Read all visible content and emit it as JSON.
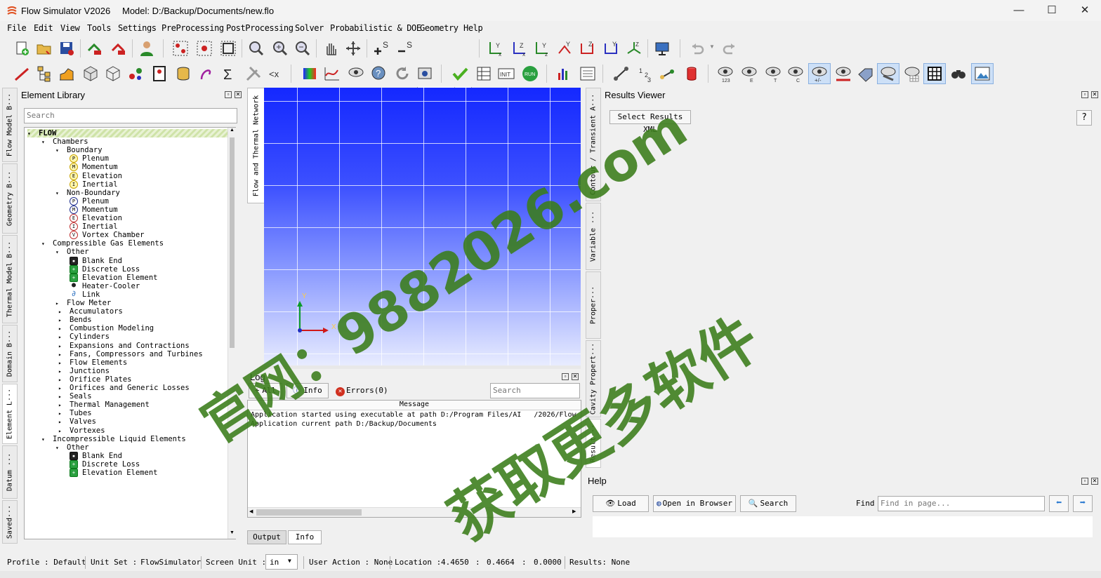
{
  "window": {
    "app_title": "Flow Simulator V2026",
    "model_label": "Model: D:/Backup/Documents/new.flo"
  },
  "menu": [
    "File",
    "Edit",
    "View",
    "Tools",
    "Settings",
    "PreProcessing",
    "PostProcessing",
    "Solver",
    "Probabilistic & DOE",
    "Geometry",
    "Help"
  ],
  "toolbar": {
    "font_size_value": "12",
    "font_icon_label": "T↕"
  },
  "left_tabs": [
    "Flow Model B···",
    "Geometry B···",
    "Thermal Model B···",
    "Domain B···",
    "Element L···",
    "Datum ···",
    "Saved···"
  ],
  "element_library": {
    "title": "Element Library",
    "search_placeholder": "Search",
    "tree": [
      {
        "d": 0,
        "arr": "▾",
        "label": "FLOW",
        "bold": true
      },
      {
        "d": 1,
        "arr": "▾",
        "label": "Chambers"
      },
      {
        "d": 2,
        "arr": "▾",
        "label": "Boundary"
      },
      {
        "d": 3,
        "icon": "P",
        "ic": "yellow",
        "label": "Plenum"
      },
      {
        "d": 3,
        "icon": "M",
        "ic": "yellow",
        "label": "Momentum"
      },
      {
        "d": 3,
        "icon": "E",
        "ic": "yellow",
        "label": "Elevation"
      },
      {
        "d": 3,
        "icon": "I",
        "ic": "yellow",
        "label": "Inertial"
      },
      {
        "d": 2,
        "arr": "▾",
        "label": "Non-Boundary"
      },
      {
        "d": 3,
        "icon": "P",
        "ic": "blue",
        "label": "Plenum"
      },
      {
        "d": 3,
        "icon": "M",
        "ic": "blue",
        "label": "Momentum"
      },
      {
        "d": 3,
        "icon": "E",
        "ic": "red",
        "label": "Elevation"
      },
      {
        "d": 3,
        "icon": "I",
        "ic": "red",
        "label": "Inertial"
      },
      {
        "d": 3,
        "icon": "V",
        "ic": "red",
        "label": "Vortex Chamber"
      },
      {
        "d": 1,
        "arr": "▾",
        "label": "Compressible Gas Elements"
      },
      {
        "d": 2,
        "arr": "▾",
        "label": "Other"
      },
      {
        "d": 3,
        "icon": "▪",
        "ic": "black",
        "label": "Blank End"
      },
      {
        "d": 3,
        "icon": "+",
        "ic": "green",
        "label": "Discrete Loss"
      },
      {
        "d": 3,
        "icon": "+",
        "ic": "green",
        "label": "Elevation Element"
      },
      {
        "d": 3,
        "icon": "●",
        "ic": "dot",
        "label": "Heater-Cooler"
      },
      {
        "d": 3,
        "icon": "∂",
        "ic": "link",
        "label": "Link"
      },
      {
        "d": 2,
        "arr": "▸",
        "label": "Flow Meter"
      },
      {
        "d": 1.6,
        "arr": "▸",
        "label": "Accumulators"
      },
      {
        "d": 1.6,
        "arr": "▸",
        "label": "Bends"
      },
      {
        "d": 1.6,
        "arr": "▸",
        "label": "Combustion Modeling"
      },
      {
        "d": 1.6,
        "arr": "▸",
        "label": "Cylinders"
      },
      {
        "d": 1.6,
        "arr": "▸",
        "label": "Expansions and Contractions"
      },
      {
        "d": 1.6,
        "arr": "▸",
        "label": "Fans, Compressors and Turbines"
      },
      {
        "d": 1.6,
        "arr": "▸",
        "label": "Flow Elements"
      },
      {
        "d": 1.6,
        "arr": "▸",
        "label": "Junctions"
      },
      {
        "d": 1.6,
        "arr": "▸",
        "label": "Orifice Plates"
      },
      {
        "d": 1.6,
        "arr": "▸",
        "label": "Orifices and Generic Losses"
      },
      {
        "d": 1.6,
        "arr": "▸",
        "label": "Seals"
      },
      {
        "d": 1.6,
        "arr": "▸",
        "label": "Thermal Management"
      },
      {
        "d": 1.6,
        "arr": "▸",
        "label": "Tubes"
      },
      {
        "d": 1.6,
        "arr": "▸",
        "label": "Valves"
      },
      {
        "d": 1.6,
        "arr": "▸",
        "label": "Vortexes"
      },
      {
        "d": 1,
        "arr": "▾",
        "label": "Incompressible Liquid Elements"
      },
      {
        "d": 2,
        "arr": "▾",
        "label": "Other"
      },
      {
        "d": 3,
        "icon": "▪",
        "ic": "black",
        "label": "Blank End"
      },
      {
        "d": 3,
        "icon": "+",
        "ic": "green",
        "label": "Discrete Loss"
      },
      {
        "d": 3,
        "icon": "+",
        "ic": "green",
        "label": "Elevation Element"
      }
    ]
  },
  "canvas": {
    "side_tab": "Flow and Thermal Network",
    "axis_y": "Y",
    "axis_x": "X"
  },
  "log": {
    "title": "Log",
    "all_button": "All",
    "info_button": "Info",
    "errors_button": "Errors(0)",
    "search_placeholder": "Search",
    "column": "Message",
    "lines": [
      "Application started using executable at path D:/Program Files/AI   /2026/Flow",
      "Application current  path D:/Backup/Documents"
    ],
    "tabs": [
      "Output",
      "Info"
    ]
  },
  "right_tabs": [
    "Contour / Transient A···",
    "Variable ···",
    "Proper···",
    "Cavity Propert···",
    "Result···"
  ],
  "results_viewer": {
    "title": "Results Viewer",
    "select_button": "Select Results XML",
    "help_icon": "?"
  },
  "help": {
    "title": "Help",
    "load": "Load",
    "open_browser": "Open in Browser",
    "search": "Search",
    "find_label": "Find",
    "find_placeholder": "Find in page..."
  },
  "status": {
    "profile": "Profile : Default",
    "unit_set_label": "Unit Set :",
    "unit_set_value": "FlowSimulator",
    "screen_unit_label": "Screen Unit :",
    "screen_unit_value": "in",
    "user_action": "User Action : None",
    "location_label": "Location :",
    "loc_x": "4.4650",
    "loc_y": "0.4664",
    "loc_z": "0.0000",
    "results": "Results: None"
  },
  "watermark": {
    "line1": "官网：9882026.com",
    "line2": "获取更多软件"
  }
}
